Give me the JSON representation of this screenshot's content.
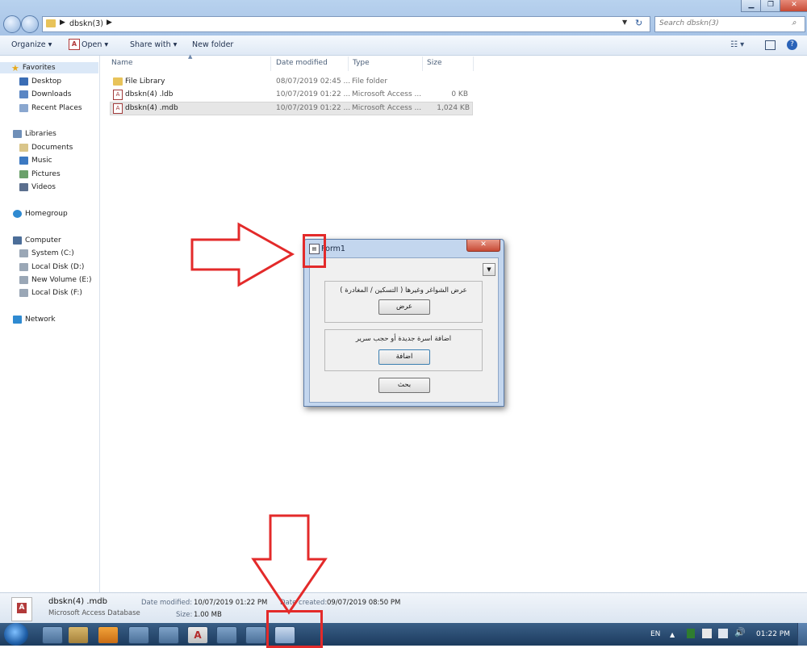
{
  "window": {
    "breadcrumb": "dbskn(3)",
    "search_placeholder": "Search dbskn(3)"
  },
  "toolbar": {
    "organize": "Organize",
    "open": "Open",
    "share_with": "Share with",
    "new_folder": "New folder"
  },
  "sidebar": {
    "favorites": "Favorites",
    "desktop": "Desktop",
    "downloads": "Downloads",
    "recent_places": "Recent Places",
    "libraries": "Libraries",
    "documents": "Documents",
    "music": "Music",
    "pictures": "Pictures",
    "videos": "Videos",
    "homegroup": "Homegroup",
    "computer": "Computer",
    "system_c": "System (C:)",
    "local_d": "Local Disk (D:)",
    "new_volume_e": "New Volume (E:)",
    "local_f": "Local Disk (F:)",
    "network": "Network"
  },
  "columns": {
    "name": "Name",
    "date": "Date modified",
    "type": "Type",
    "size": "Size"
  },
  "files": [
    {
      "name": "File Library",
      "date": "08/07/2019 02:45 ...",
      "type": "File folder",
      "size": ""
    },
    {
      "name": "dbskn(4) .ldb",
      "date": "10/07/2019 01:22 ...",
      "type": "Microsoft Access ...",
      "size": "0 KB"
    },
    {
      "name": "dbskn(4) .mdb",
      "date": "10/07/2019 01:22 ...",
      "type": "Microsoft Access ...",
      "size": "1,024 KB"
    }
  ],
  "details": {
    "filename": "dbskn(4) .mdb",
    "filetype": "Microsoft Access Database",
    "date_modified_label": "Date modified:",
    "date_modified": "10/07/2019 01:22 PM",
    "date_created_label": "Date created:",
    "date_created": "09/07/2019 08:50 PM",
    "size_label": "Size:",
    "size": "1.00 MB"
  },
  "dialog": {
    "title": "Form1",
    "group1_text": "عرض الشواغر وغيرها ( التسكين / المغادرة )",
    "group1_button": "عرض",
    "group2_text": "اضافة اسرة جديدة أو حجب سرير",
    "group2_button": "اضافة",
    "search_button": "بحث"
  },
  "tray": {
    "lang": "EN",
    "time": "01:22 PM"
  },
  "colors": {
    "annotation_red": "#e32a2a",
    "selection": "#e6e6e6"
  }
}
